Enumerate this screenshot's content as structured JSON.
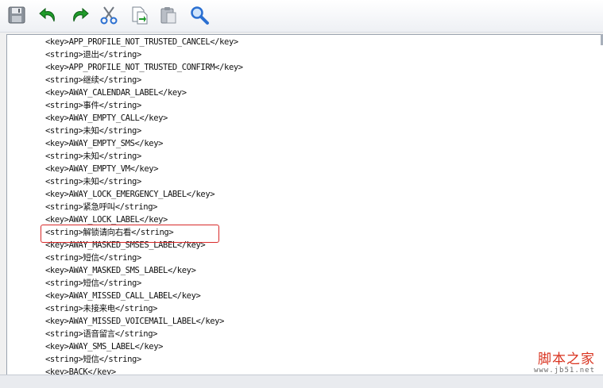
{
  "toolbar": {
    "buttons": [
      {
        "name": "save-button",
        "icon": "floppy-disk-icon"
      },
      {
        "name": "undo-button",
        "icon": "undo-arrow-icon"
      },
      {
        "name": "redo-button",
        "icon": "redo-arrow-icon"
      },
      {
        "name": "cut-button",
        "icon": "scissors-icon"
      },
      {
        "name": "copy-button",
        "icon": "copy-document-icon"
      },
      {
        "name": "paste-button",
        "icon": "clipboard-icon"
      },
      {
        "name": "find-button",
        "icon": "magnifier-icon"
      }
    ]
  },
  "editor": {
    "lines": [
      "<key>APP_PROFILE_NOT_TRUSTED_CANCEL</key>",
      "<string>退出</string>",
      "<key>APP_PROFILE_NOT_TRUSTED_CONFIRM</key>",
      "<string>继续</string>",
      "<key>AWAY_CALENDAR_LABEL</key>",
      "<string>事件</string>",
      "<key>AWAY_EMPTY_CALL</key>",
      "<string>未知</string>",
      "<key>AWAY_EMPTY_SMS</key>",
      "<string>未知</string>",
      "<key>AWAY_EMPTY_VM</key>",
      "<string>未知</string>",
      "<key>AWAY_LOCK_EMERGENCY_LABEL</key>",
      "<string>紧急呼叫</string>",
      "<key>AWAY_LOCK_LABEL</key>",
      "<string>解锁请向右看</string>",
      "<key>AWAY_MASKED_SMSES_LABEL</key>",
      "<string>短信</string>",
      "<key>AWAY_MASKED_SMS_LABEL</key>",
      "<string>短信</string>",
      "<key>AWAY_MISSED_CALL_LABEL</key>",
      "<string>未接来电</string>",
      "<key>AWAY_MISSED_VOICEMAIL_LABEL</key>",
      "<string>语音留言</string>",
      "<key>AWAY_SMS_LABEL</key>",
      "<string>短信</string>",
      "<key>BACK</key>"
    ],
    "highlighted_line_index": 15
  },
  "watermark": {
    "title": "脚本之家",
    "url": "www.jb51.net"
  },
  "colors": {
    "highlight_border": "#d82a2a",
    "watermark": "#d9331f",
    "icon_green": "#1f9b2a",
    "icon_blue": "#2a6fd1"
  }
}
